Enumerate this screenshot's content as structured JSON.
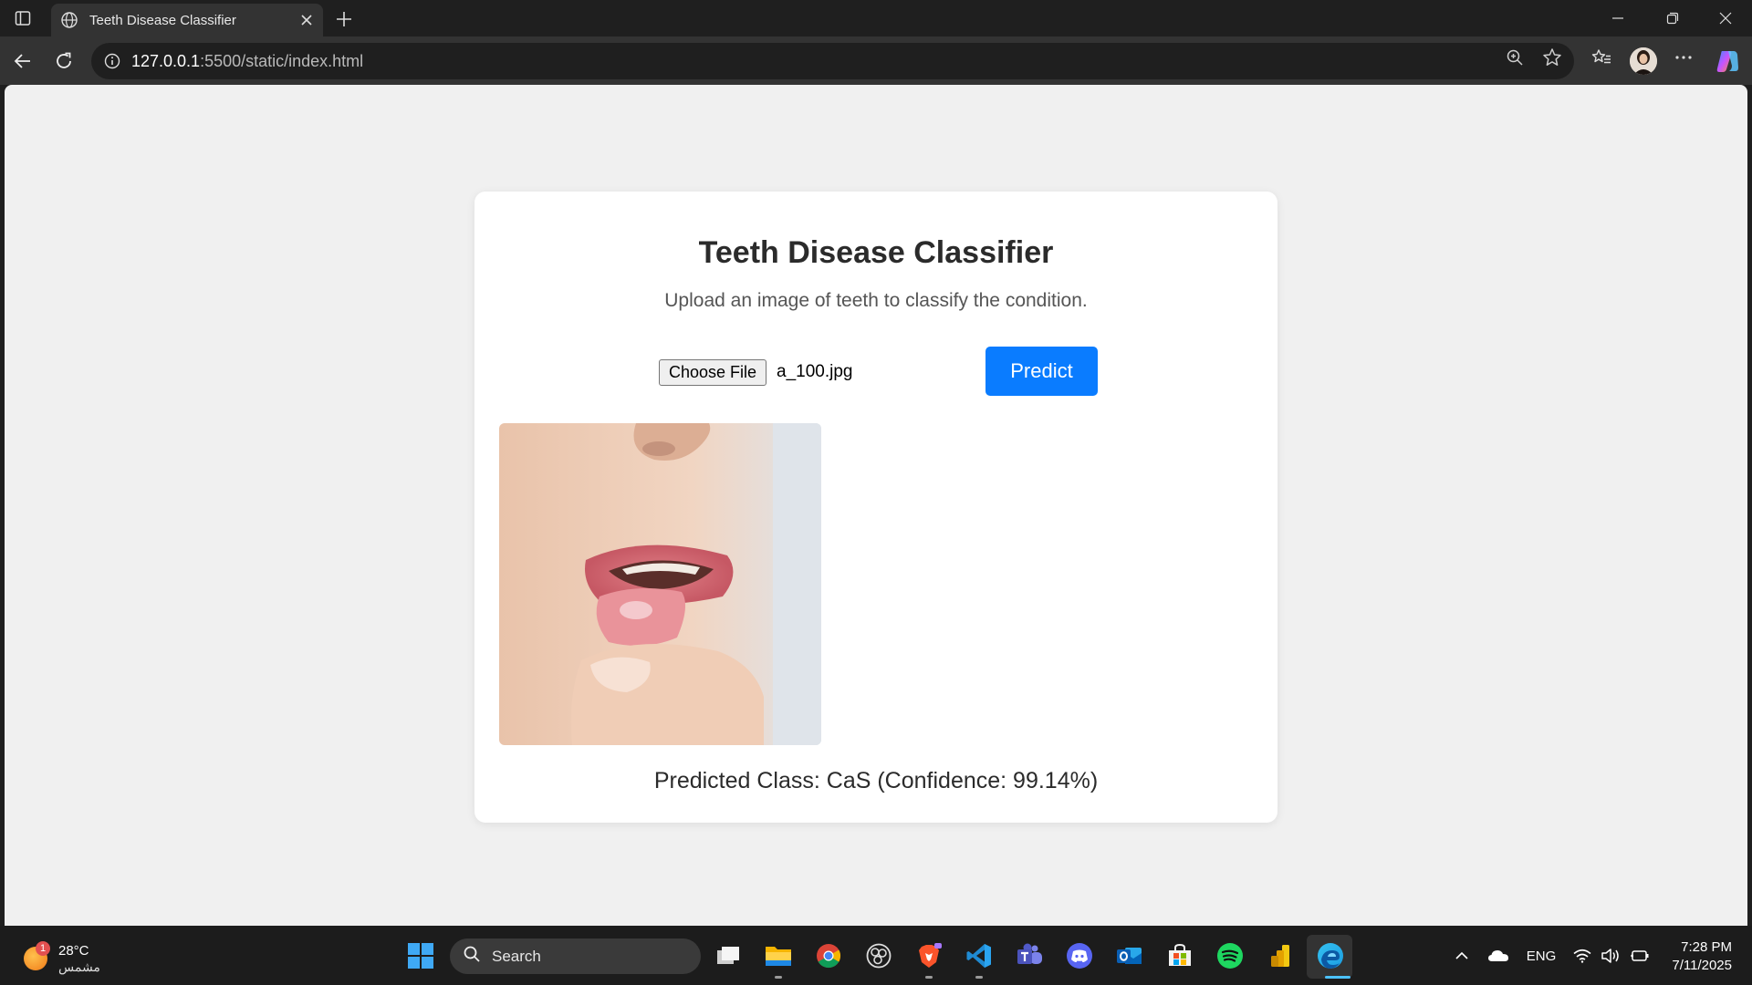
{
  "browser": {
    "tab_title": "Teeth Disease Classifier",
    "url_host": "127.0.0.1",
    "url_path": ":5500/static/index.html"
  },
  "page": {
    "title": "Teeth Disease Classifier",
    "subtitle": "Upload an image of teeth to classify the condition.",
    "file_button_label": "Choose File",
    "file_name": "a_100.jpg",
    "predict_label": "Predict",
    "result_text": "Predicted Class: CaS (Confidence: 99.14%)"
  },
  "taskbar": {
    "weather_temp": "28°C",
    "weather_condition": "مشمس",
    "weather_badge": "1",
    "search_label": "Search",
    "language": "ENG",
    "time": "7:28 PM",
    "date": "7/11/2025"
  },
  "colors": {
    "accent": "#0a7cff",
    "page_bg": "#f0f0f0",
    "card_bg": "#ffffff"
  },
  "icons": [
    "sidebar-toggle-icon",
    "globe-icon",
    "close-icon",
    "plus-icon",
    "minimize-icon",
    "restore-icon",
    "window-close-icon",
    "back-icon",
    "refresh-icon",
    "info-icon",
    "zoom-icon",
    "star-icon",
    "favorites-icon",
    "more-icon",
    "copilot-icon",
    "windows-start-icon",
    "search-icon",
    "task-view-icon",
    "file-explorer-icon",
    "chrome-icon",
    "obs-icon",
    "brave-icon",
    "vscode-icon",
    "teams-icon",
    "discord-icon",
    "outlook-icon",
    "store-icon",
    "spotify-icon",
    "powerbi-icon",
    "edge-icon",
    "chevron-up-icon",
    "onedrive-icon",
    "wifi-icon",
    "volume-icon",
    "battery-icon"
  ]
}
